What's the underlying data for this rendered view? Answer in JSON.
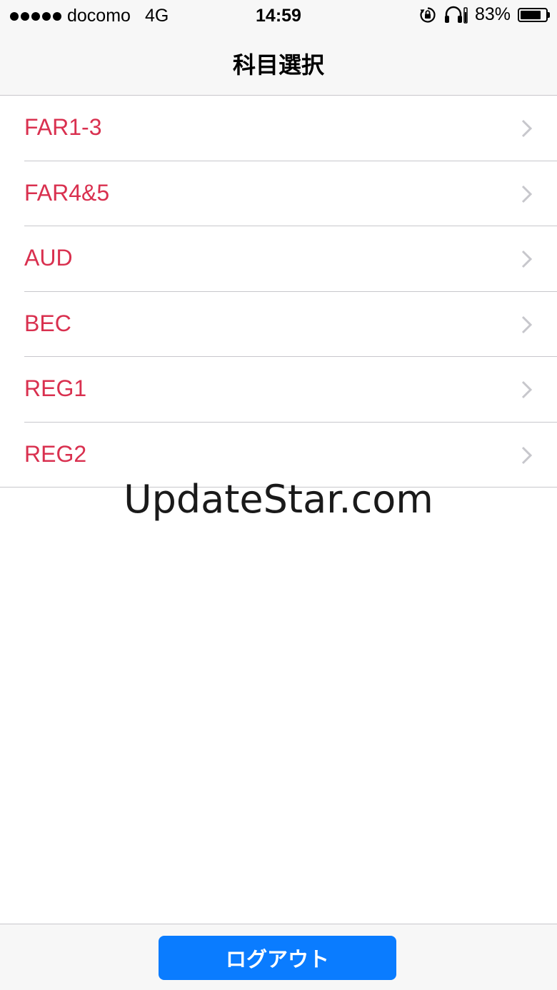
{
  "status_bar": {
    "carrier": "docomo",
    "network": "4G",
    "time": "14:59",
    "battery": "83%",
    "battery_level": 0.83,
    "icons": [
      "signal-dots-icon",
      "orientation-lock-icon",
      "headphones-icon",
      "battery-icon"
    ]
  },
  "nav": {
    "title": "科目選択"
  },
  "subjects": [
    {
      "label": "FAR1-3"
    },
    {
      "label": "FAR4&5"
    },
    {
      "label": "AUD"
    },
    {
      "label": "BEC"
    },
    {
      "label": "REG1"
    },
    {
      "label": "REG2"
    }
  ],
  "watermark": "UpdateStar.com",
  "toolbar": {
    "logout_label": "ログアウト"
  },
  "colors": {
    "accent_red": "#d9304f",
    "button_blue": "#0a7cff",
    "bar_background": "#f7f7f7",
    "separator": "#c8c7cc"
  }
}
